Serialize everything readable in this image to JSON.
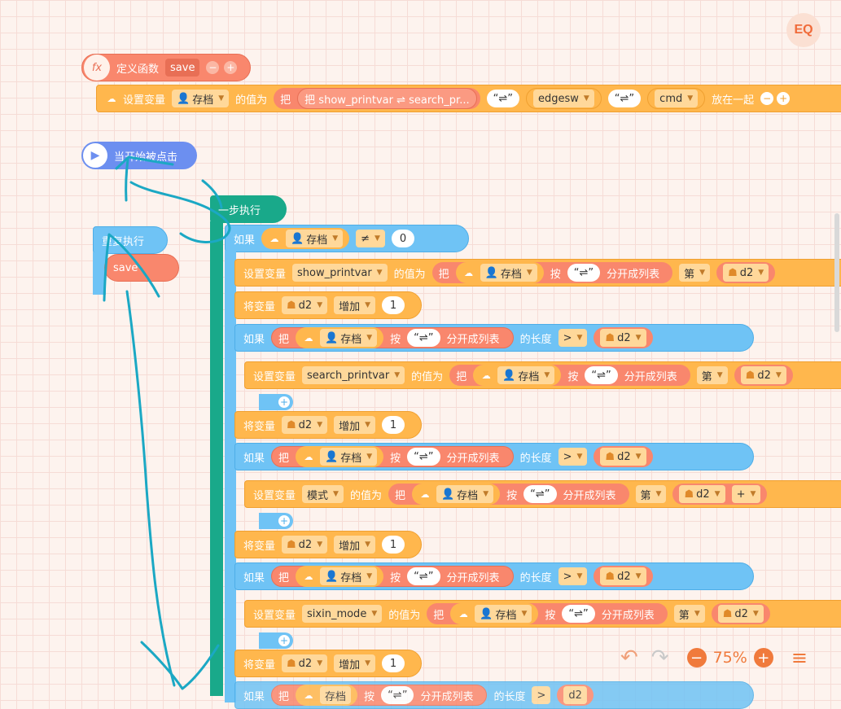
{
  "app": {
    "logo_text": "EQ"
  },
  "define": {
    "label": "定义函数",
    "name": "save",
    "set_var_label": "设置变量",
    "var": "存档",
    "value_label": "的值为",
    "join_label": "把",
    "joined_text": "把 show_printvar ⇌ search_pr...",
    "sep1": "“⇌”",
    "var2": "edgesw",
    "sep2": "“⇌”",
    "var3": "cmd",
    "together": "放在一起"
  },
  "start": {
    "label": "当开始被点击"
  },
  "repeat": {
    "label": "重复执行",
    "call": "save"
  },
  "step": {
    "label": "一步执行"
  },
  "if1": {
    "label": "如果",
    "var": "存档",
    "op": "≠",
    "value": "0"
  },
  "set1": {
    "label": "设置变量",
    "var": "show_printvar",
    "value_label": "的值为",
    "ba": "把",
    "src": "存档",
    "an": "按",
    "sep": "“⇌”",
    "split": "分开成列表",
    "di": "第",
    "idx": "d2"
  },
  "inc_blocks": [
    {
      "label": "将变量",
      "var": "d2",
      "op": "增加",
      "value": "1"
    },
    {
      "label": "将变量",
      "var": "d2",
      "op": "增加",
      "value": "1"
    },
    {
      "label": "将变量",
      "var": "d2",
      "op": "增加",
      "value": "1"
    },
    {
      "label": "将变量",
      "var": "d2",
      "op": "增加",
      "value": "1"
    }
  ],
  "if_blocks": [
    {
      "label": "如果",
      "ba": "把",
      "src": "存档",
      "an": "按",
      "sep": "“⇌”",
      "split": "分开成列表",
      "len": "的长度",
      "op": ">",
      "var": "d2"
    },
    {
      "label": "如果",
      "ba": "把",
      "src": "存档",
      "an": "按",
      "sep": "“⇌”",
      "split": "分开成列表",
      "len": "的长度",
      "op": ">",
      "var": "d2"
    },
    {
      "label": "如果",
      "ba": "把",
      "src": "存档",
      "an": "按",
      "sep": "“⇌”",
      "split": "分开成列表",
      "len": "的长度",
      "op": ">",
      "var": "d2"
    },
    {
      "label": "如果",
      "ba": "把",
      "src": "存档",
      "an": "按",
      "sep": "“⇌”",
      "split": "分开成列表",
      "len": "的长度",
      "op": ">",
      "var": "d2"
    }
  ],
  "set_blocks": [
    {
      "label": "设置变量",
      "var": "search_printvar",
      "value_label": "的值为",
      "ba": "把",
      "src": "存档",
      "an": "按",
      "sep": "“⇌”",
      "split": "分开成列表",
      "di": "第",
      "idx": "d2"
    },
    {
      "label": "设置变量",
      "var": "模式",
      "value_label": "的值为",
      "ba": "把",
      "src": "存档",
      "an": "按",
      "sep": "“⇌”",
      "split": "分开成列表",
      "di": "第",
      "idx": "d2",
      "extra": "+"
    },
    {
      "label": "设置变量",
      "var": "sixin_mode",
      "value_label": "的值为",
      "ba": "把",
      "src": "存档",
      "an": "按",
      "sep": "“⇌”",
      "split": "分开成列表",
      "di": "第",
      "idx": "d2"
    }
  ],
  "toolbar": {
    "undo": "↶",
    "redo": "↷",
    "zoom_out": "−",
    "zoom": "75%",
    "zoom_in": "+",
    "align": "≡"
  },
  "colors": {
    "orange": "#ffb74d",
    "salmon": "#f9876d",
    "blue": "#6fc3f5",
    "green": "#19a98a",
    "violet": "#6c8ff0",
    "annotation": "#1ba8c4"
  }
}
